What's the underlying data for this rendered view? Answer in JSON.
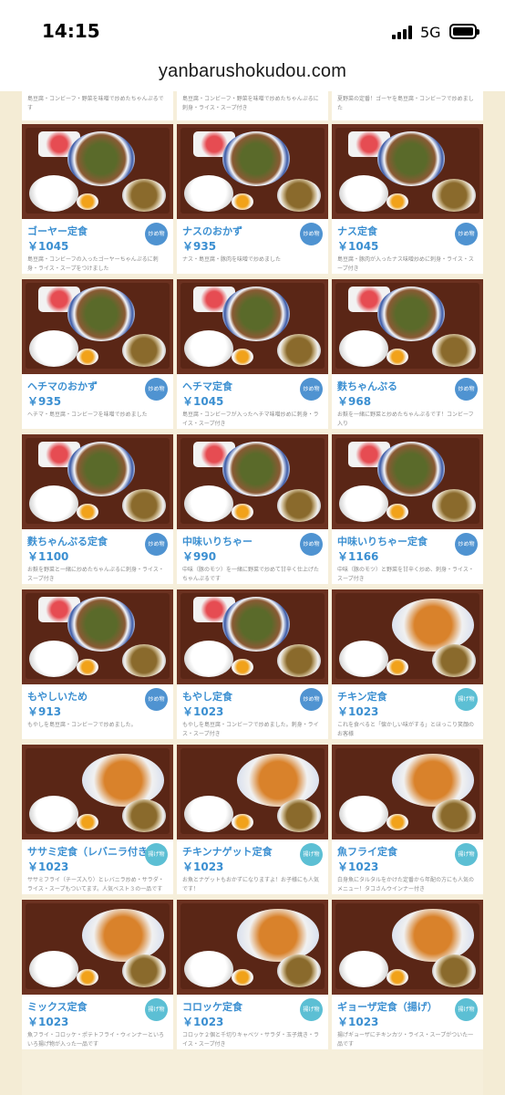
{
  "status": {
    "time": "14:15",
    "network": "5G"
  },
  "browser": {
    "url": "yanbarushokudou.com"
  },
  "top_partial": [
    "島豆腐・コンビーフ・野菜を味噌で炒めたちゃんぷるです",
    "島豆腐・コンビーフ・野菜を味噌で炒めたちゃんぷるに刺身・ライス・スープ付き",
    "夏野菜の定番！ゴーヤを島豆腐・コンビーフで炒めました"
  ],
  "menu": [
    {
      "name": "ゴーヤー定食",
      "price": "￥1045",
      "badge": "炒め物",
      "desc": "島豆腐・コンビーフの入ったゴーヤーちゃんぷるに刺身・ライス・スープをつけました"
    },
    {
      "name": "ナスのおかず",
      "price": "￥935",
      "badge": "炒め物",
      "desc": "ナス・島豆腐・豚肉を味噌で炒めました"
    },
    {
      "name": "ナス定食",
      "price": "￥1045",
      "badge": "炒め物",
      "desc": "島豆腐・豚肉が入ったナス味噌炒めに刺身・ライス・スープ付き"
    },
    {
      "name": "ヘチマのおかず",
      "price": "￥935",
      "badge": "炒め物",
      "desc": "ヘチマ・島豆腐・コンビーフを味噌で炒めました"
    },
    {
      "name": "ヘチマ定食",
      "price": "￥1045",
      "badge": "炒め物",
      "desc": "島豆腐・コンビーフが入ったヘチマ味噌炒めに刺身・ライス・スープ付き"
    },
    {
      "name": "麩ちゃんぷる",
      "price": "￥968",
      "badge": "炒め物",
      "desc": "お麩を一緒に野菜と炒めたちゃんぷるです！コンビーフ入り"
    },
    {
      "name": "麩ちゃんぷる定食",
      "price": "￥1100",
      "badge": "炒め物",
      "desc": "お麩を野菜と一緒に炒めたちゃんぷるに刺身・ライス・スープ付き"
    },
    {
      "name": "中味いりちゃー",
      "price": "￥990",
      "badge": "炒め物",
      "desc": "中味（豚のモツ）を一緒に野菜で炒めて甘辛く仕上げたちゃんぷるです"
    },
    {
      "name": "中味いりちゃー定食",
      "price": "￥1166",
      "badge": "炒め物",
      "desc": "中味（豚のモツ）と野菜を甘辛く炒め、刺身・ライス・スープ付き"
    },
    {
      "name": "もやしいため",
      "price": "￥913",
      "badge": "炒め物",
      "desc": "もやしを島豆腐・コンビーフで炒めました。"
    },
    {
      "name": "もやし定食",
      "price": "￥1023",
      "badge": "炒め物",
      "desc": "もやしを島豆腐・コンビーフで炒めました。刺身・ライス・スープ付き"
    },
    {
      "name": "チキン定食",
      "price": "￥1023",
      "badge": "揚げ物",
      "desc": "これを食べると「懐かしい味がする」とほっこり笑顔のお客様"
    },
    {
      "name": "ササミ定食（レバニラ付き）",
      "price": "￥1023",
      "badge": "揚げ物",
      "desc": "ササミフライ（チーズ入り）とレバニラ炒め・サラダ・ライス・スープもついてます。人気ベスト３の一品です"
    },
    {
      "name": "チキンナゲット定食",
      "price": "￥1023",
      "badge": "揚げ物",
      "desc": "お魚とナゲットもおかずになりますよ！お子様にも人気です！"
    },
    {
      "name": "魚フライ定食",
      "price": "￥1023",
      "badge": "揚げ物",
      "desc": "白身魚にタルタルをかけた定番から年配の方にも人気のメニュー！タコさんウインナー付き"
    },
    {
      "name": "ミックス定食",
      "price": "￥1023",
      "badge": "揚げ物",
      "desc": "魚フライ・コロッケ・ポテトフライ・ウィンナーといろいろ揚げ物が入った一品です"
    },
    {
      "name": "コロッケ定食",
      "price": "￥1023",
      "badge": "揚げ物",
      "desc": "コロッケ２個と千切りキャベツ・サラダ・玉子焼き・ライス・スープ付き"
    },
    {
      "name": "ギョーザ定食（揚げ）",
      "price": "￥1023",
      "badge": "揚げ物",
      "desc": "揚げギョーザにチキンカツ・ライス・スープがついた一品です"
    }
  ]
}
